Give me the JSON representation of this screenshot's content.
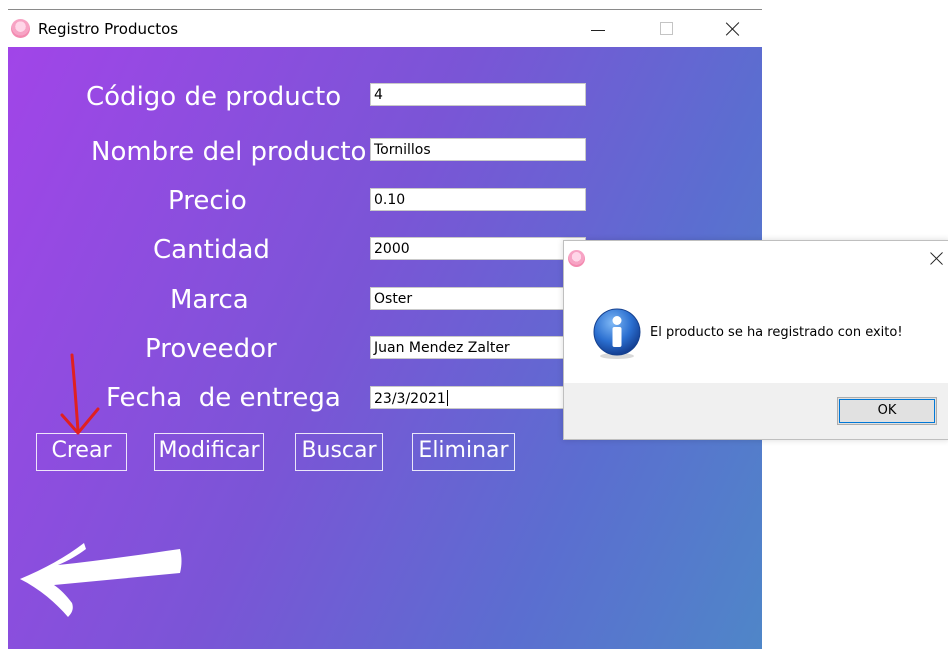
{
  "window": {
    "title": "Registro Productos"
  },
  "form": {
    "fields": [
      {
        "label": "Código de producto",
        "value": "4"
      },
      {
        "label": "Nombre del producto",
        "value": "Tornillos"
      },
      {
        "label": "Precio",
        "value": "0.10"
      },
      {
        "label": "Cantidad",
        "value": "2000"
      },
      {
        "label": "Marca",
        "value": "Oster"
      },
      {
        "label": "Proveedor",
        "value": "Juan Mendez Zalter"
      },
      {
        "label": "Fecha  de entrega",
        "value": "23/3/2021"
      }
    ],
    "buttons": {
      "create": "Crear",
      "modify": "Modificar",
      "search": "Buscar",
      "delete": "Eliminar"
    }
  },
  "dialog": {
    "message": "El producto se ha registrado con exito!",
    "ok_label": "OK"
  },
  "icons": {
    "app": "donut-icon",
    "back": "back-arrow-icon",
    "annotation": "red-arrow-annotation",
    "info": "info-icon"
  },
  "colors": {
    "gradient_start": "#a145e8",
    "gradient_end": "#4f86c8",
    "annotation": "#e02020"
  }
}
